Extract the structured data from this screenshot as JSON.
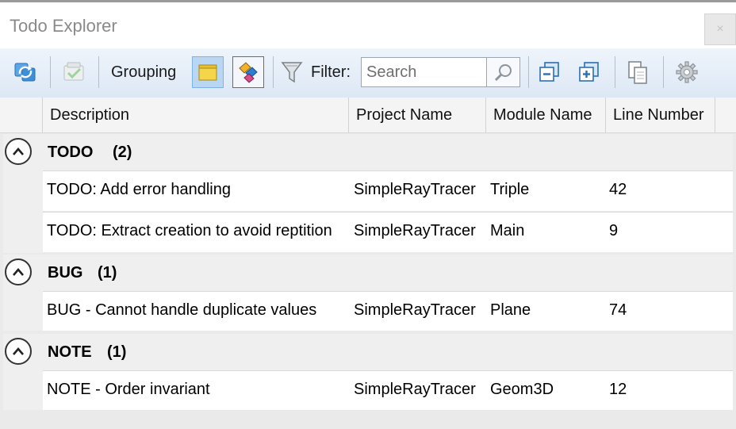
{
  "window": {
    "title": "Todo Explorer",
    "close_glyph": "×"
  },
  "toolbar": {
    "grouping_label": "Grouping",
    "filter_label": "Filter:",
    "search_placeholder": "Search",
    "icons": [
      "refresh-icon",
      "checklist-icon",
      "sticky-note-icon",
      "tag-group-icon",
      "filter-funnel-icon",
      "magnifier-icon",
      "collapse-all-icon",
      "expand-all-icon",
      "copy-icon",
      "gear-icon"
    ]
  },
  "columns": {
    "description": "Description",
    "project": "Project Name",
    "module": "Module Name",
    "line": "Line Number"
  },
  "groups": [
    {
      "name": "TODO",
      "count": "(2)",
      "rows": [
        {
          "description": "TODO: Add error handling",
          "project": "SimpleRayTracer",
          "module": "Triple",
          "line": "42"
        },
        {
          "description": "TODO: Extract creation to avoid reptition",
          "project": "SimpleRayTracer",
          "module": "Main",
          "line": "9"
        }
      ]
    },
    {
      "name": "BUG",
      "count": "(1)",
      "rows": [
        {
          "description": "BUG - Cannot handle duplicate values",
          "project": "SimpleRayTracer",
          "module": "Plane",
          "line": "74"
        }
      ]
    },
    {
      "name": "NOTE",
      "count": "(1)",
      "rows": [
        {
          "description": "NOTE - Order invariant",
          "project": "SimpleRayTracer",
          "module": "Geom3D",
          "line": "12"
        }
      ]
    }
  ],
  "colors": {
    "toolbar_top": "#eef4fb",
    "toolbar_bottom": "#dde8f5",
    "pressed_toggle": "#b9d6f3",
    "accent_blue": "#2a7fd4"
  }
}
